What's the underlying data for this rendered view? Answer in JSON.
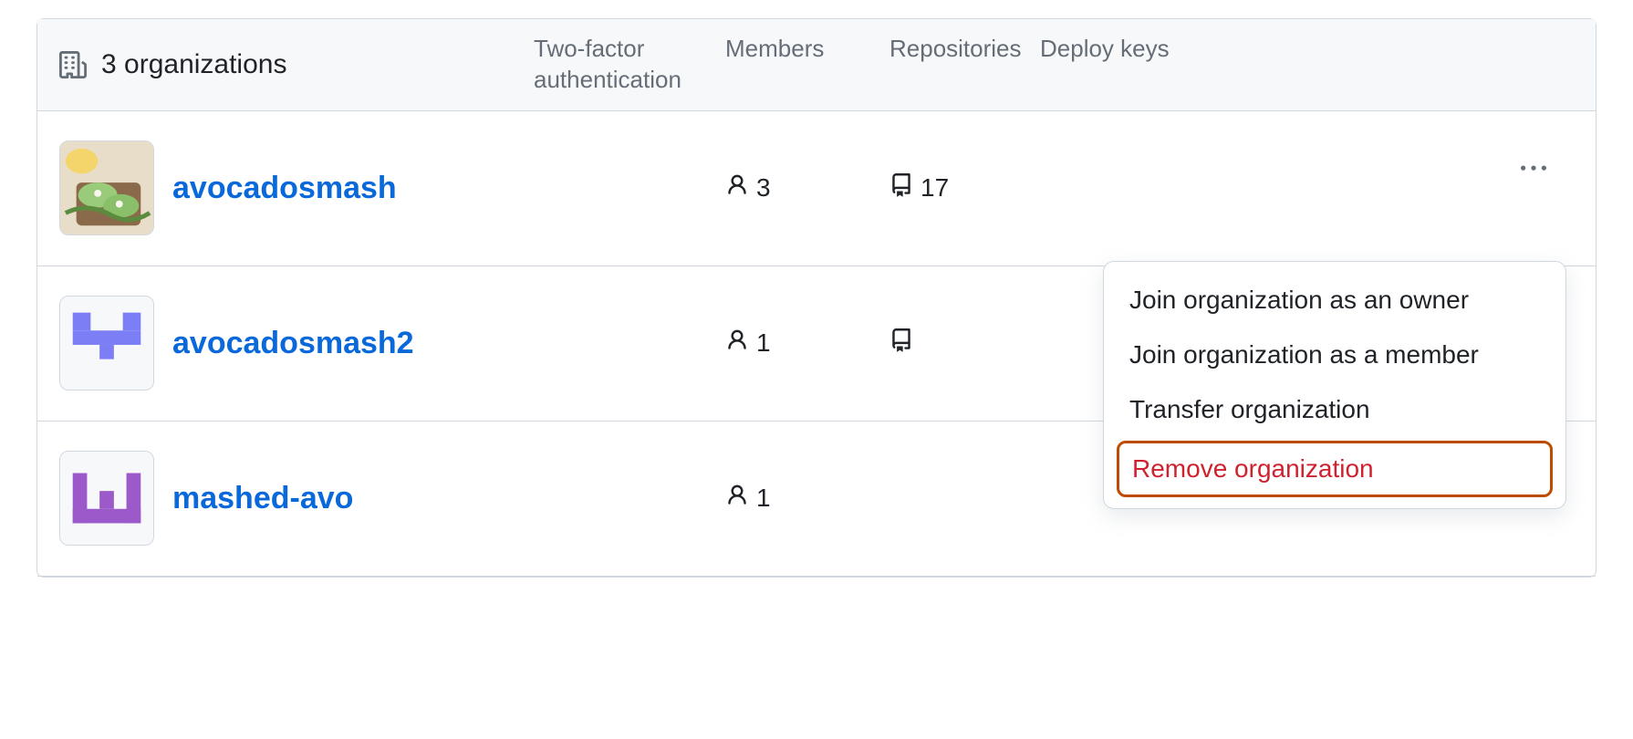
{
  "header": {
    "title": "3 organizations",
    "columns": {
      "tfa": "Two-factor authentication",
      "members": "Members",
      "repos": "Repositories",
      "deploy": "Deploy keys"
    }
  },
  "rows": [
    {
      "name": "avocadosmash",
      "avatar_type": "photo",
      "members": "3",
      "repos": "17",
      "deploy": "",
      "show_kebab": true
    },
    {
      "name": "avocadosmash2",
      "avatar_type": "identicon-blue",
      "members": "1",
      "repos": "",
      "deploy": "",
      "show_kebab": false
    },
    {
      "name": "mashed-avo",
      "avatar_type": "identicon-purple",
      "members": "1",
      "repos": "",
      "deploy": "",
      "show_kebab": false
    }
  ],
  "dropdown": {
    "join_owner": "Join organization as an owner",
    "join_member": "Join organization as a member",
    "transfer": "Transfer organization",
    "remove": "Remove organization"
  },
  "colors": {
    "link": "#0969da",
    "danger": "#cf222e",
    "highlight_border": "#bc4c00"
  }
}
